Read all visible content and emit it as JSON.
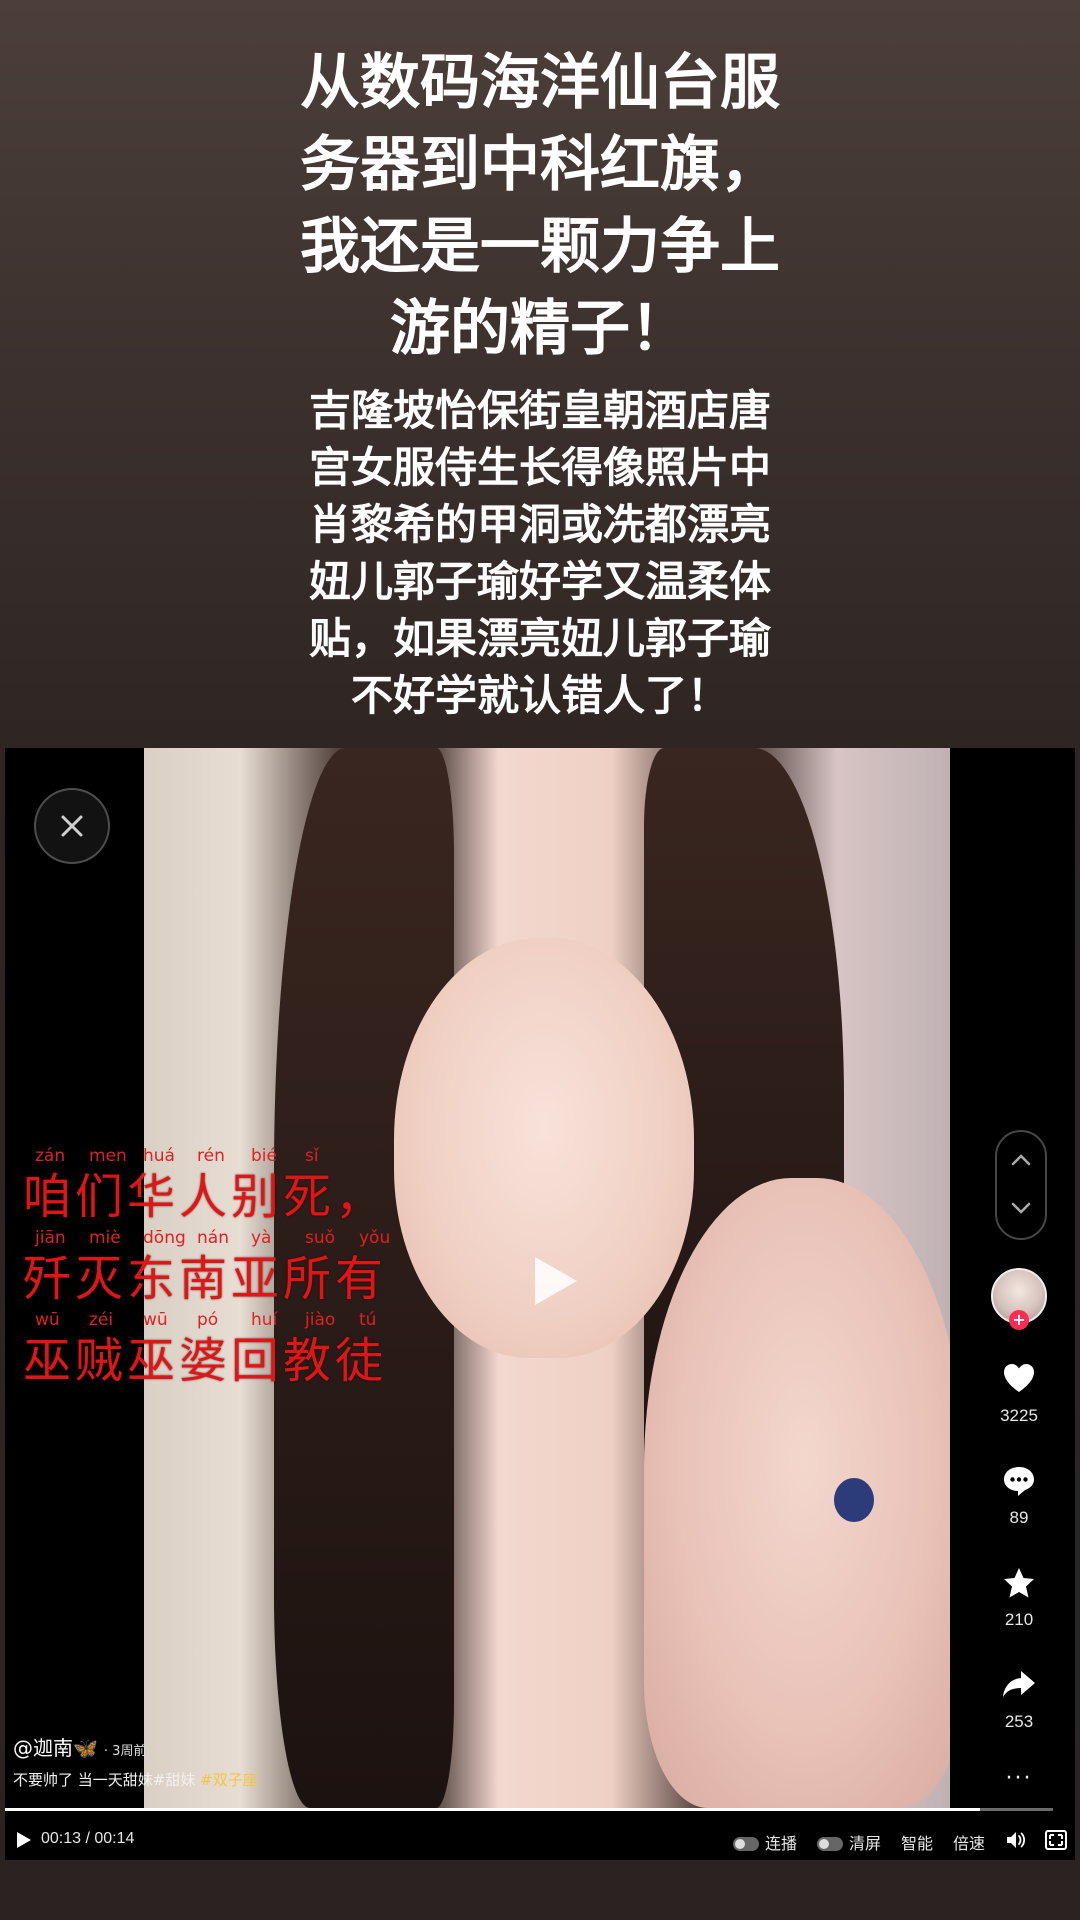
{
  "headline": {
    "lines": [
      "从数码海洋仙台服",
      "务器到中科红旗，",
      "我还是一颗力争上",
      "游的精子！"
    ]
  },
  "subtext": {
    "lines": [
      "吉隆坡怡保街皇朝酒店唐",
      "宫女服侍生长得像照片中",
      "肖黎希的甲洞或冼都漂亮",
      "妞儿郭子瑜好学又温柔体",
      "贴，如果漂亮妞儿郭子瑜",
      "不好学就认错人了！"
    ]
  },
  "video": {
    "overlay_rows": [
      {
        "pinyin": [
          "zán",
          "men",
          "huá",
          "rén",
          "bié",
          "sǐ"
        ],
        "hanzi": "咱们华人别死，"
      },
      {
        "pinyin": [
          "jiān",
          "miè",
          "dōng",
          "nán",
          "yà",
          "suǒ",
          "yǒu"
        ],
        "hanzi": "歼灭东南亚所有"
      },
      {
        "pinyin": [
          "wū",
          "zéi",
          "wū",
          "pó",
          "huí",
          "jiào",
          "tú"
        ],
        "hanzi": "巫贼巫婆回教徒"
      }
    ],
    "author": "@迦南🦋",
    "posted_ago": "· 3周前",
    "description": "不要帅了 当一天甜妹#甜妹",
    "hashtag": "#双子座",
    "progress": 0.93
  },
  "actions": {
    "likes": "3225",
    "comments": "89",
    "favorites": "210",
    "shares": "253",
    "more": "···"
  },
  "controls": {
    "time": "00:13 / 00:14",
    "autoplay_label": "连播",
    "clear_screen_label": "清屏",
    "smart_label": "智能",
    "speed_label": "倍速"
  },
  "icons": [
    "close-icon",
    "play-icon",
    "chevron-up-icon",
    "chevron-down-icon",
    "heart-icon",
    "comment-icon",
    "star-icon",
    "share-icon",
    "volume-icon",
    "fullscreen-icon"
  ]
}
